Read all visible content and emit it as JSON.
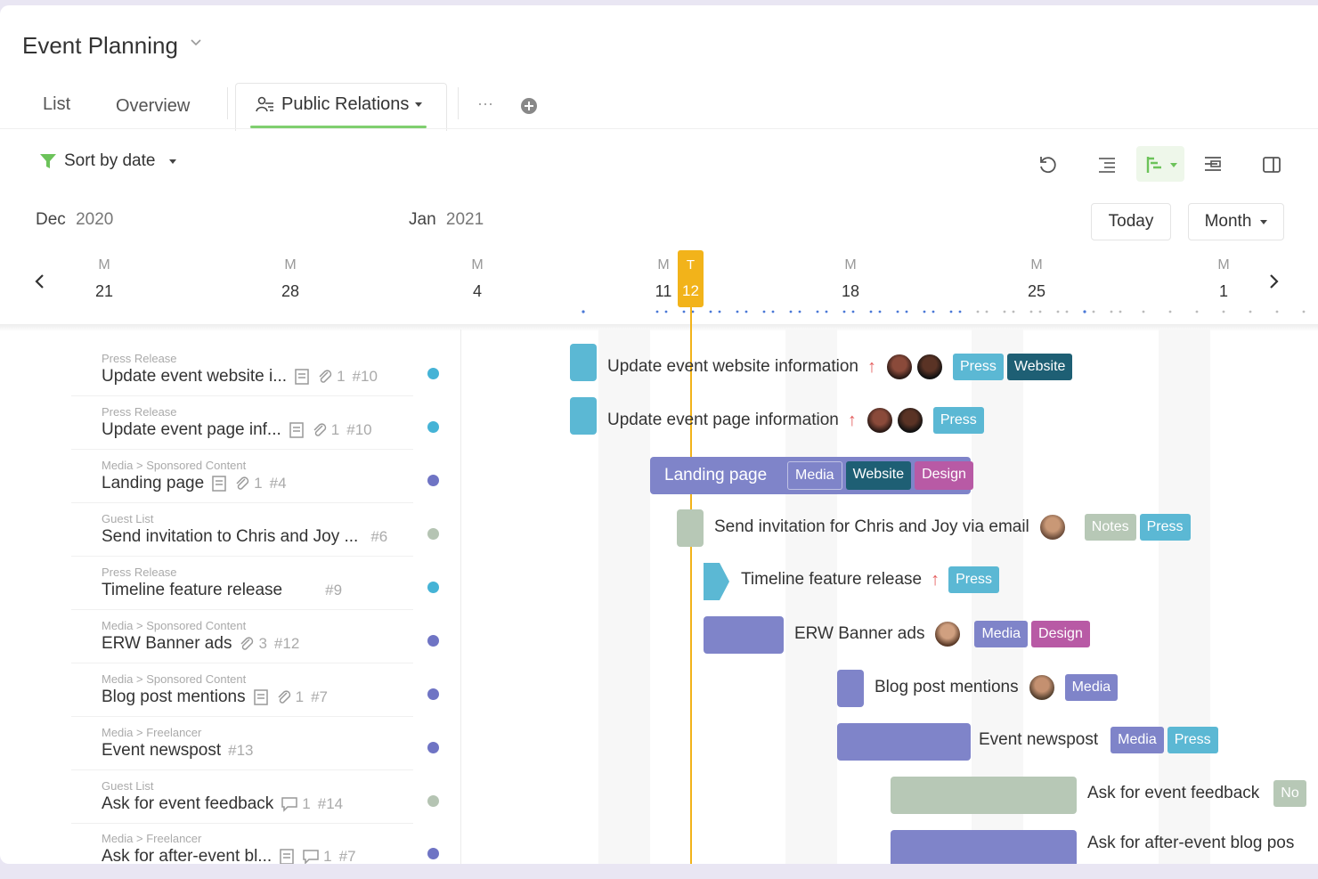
{
  "project": {
    "title": "Event Planning"
  },
  "tabs": {
    "list": "List",
    "overview": "Overview",
    "active": "Public Relations",
    "more": "···"
  },
  "toolbar": {
    "sort_label": "Sort by date"
  },
  "calendar": {
    "month_left": "Dec",
    "year_left": "2020",
    "month_right": "Jan",
    "year_right": "2021",
    "today_button": "Today",
    "view_button": "Month",
    "days": [
      {
        "letter": "M",
        "num": "21"
      },
      {
        "letter": "M",
        "num": "28"
      },
      {
        "letter": "M",
        "num": "4"
      },
      {
        "letter": "M",
        "num": "11"
      },
      {
        "letter": "M",
        "num": "18"
      },
      {
        "letter": "M",
        "num": "25"
      },
      {
        "letter": "M",
        "num": "1"
      }
    ],
    "today_letter": "T",
    "today_num": "12"
  },
  "colors": {
    "accent_green": "#7fcf6f",
    "today": "#f2b31a",
    "press": "#5bb8d4",
    "website": "#1e5f74",
    "media": "#7f84c9",
    "design": "#b85aa5",
    "notes": "#b7c8b6",
    "priority": "#e45d5d"
  },
  "tasks": [
    {
      "breadcrumb": "Press Release",
      "title": "Update event website i...",
      "attach": "1",
      "id": "#10",
      "full": "Update event website information",
      "tag1": "Press",
      "tag2": "Website"
    },
    {
      "breadcrumb": "Press Release",
      "title": "Update event page inf...",
      "attach": "1",
      "id": "#10",
      "full": "Update event page information",
      "tag1": "Press"
    },
    {
      "breadcrumb": "Media > Sponsored Content",
      "title": "Landing page",
      "attach": "1",
      "id": "#4",
      "full": "Landing page",
      "tag1": "Media",
      "tag2": "Website",
      "tag3": "Design"
    },
    {
      "breadcrumb": "Guest List",
      "title": "Send invitation to Chris and Joy ...",
      "id": "#6",
      "full": "Send invitation for Chris and Joy via email",
      "tag1": "Notes",
      "tag2": "Press"
    },
    {
      "breadcrumb": "Press Release",
      "title": "Timeline feature release",
      "id": "#9",
      "full": "Timeline feature release",
      "tag1": "Press"
    },
    {
      "breadcrumb": "Media > Sponsored Content",
      "title": "ERW Banner ads",
      "attach": "3",
      "id": "#12",
      "full": "ERW Banner ads",
      "tag1": "Media",
      "tag2": "Design"
    },
    {
      "breadcrumb": "Media > Sponsored Content",
      "title": "Blog post mentions",
      "attach": "1",
      "id": "#7",
      "full": "Blog post mentions",
      "tag1": "Media"
    },
    {
      "breadcrumb": "Media > Freelancer",
      "title": "Event newspost",
      "id": "#13",
      "full": "Event newspost",
      "tag1": "Media",
      "tag2": "Press"
    },
    {
      "breadcrumb": "Guest List",
      "title": "Ask for event feedback",
      "comments": "1",
      "id": "#14",
      "full": "Ask for event feedback",
      "tag1": "No"
    },
    {
      "breadcrumb": "Media > Freelancer",
      "title": "Ask for after-event bl...",
      "comments": "1",
      "id": "#7",
      "full": "Ask for after-event blog pos"
    }
  ]
}
